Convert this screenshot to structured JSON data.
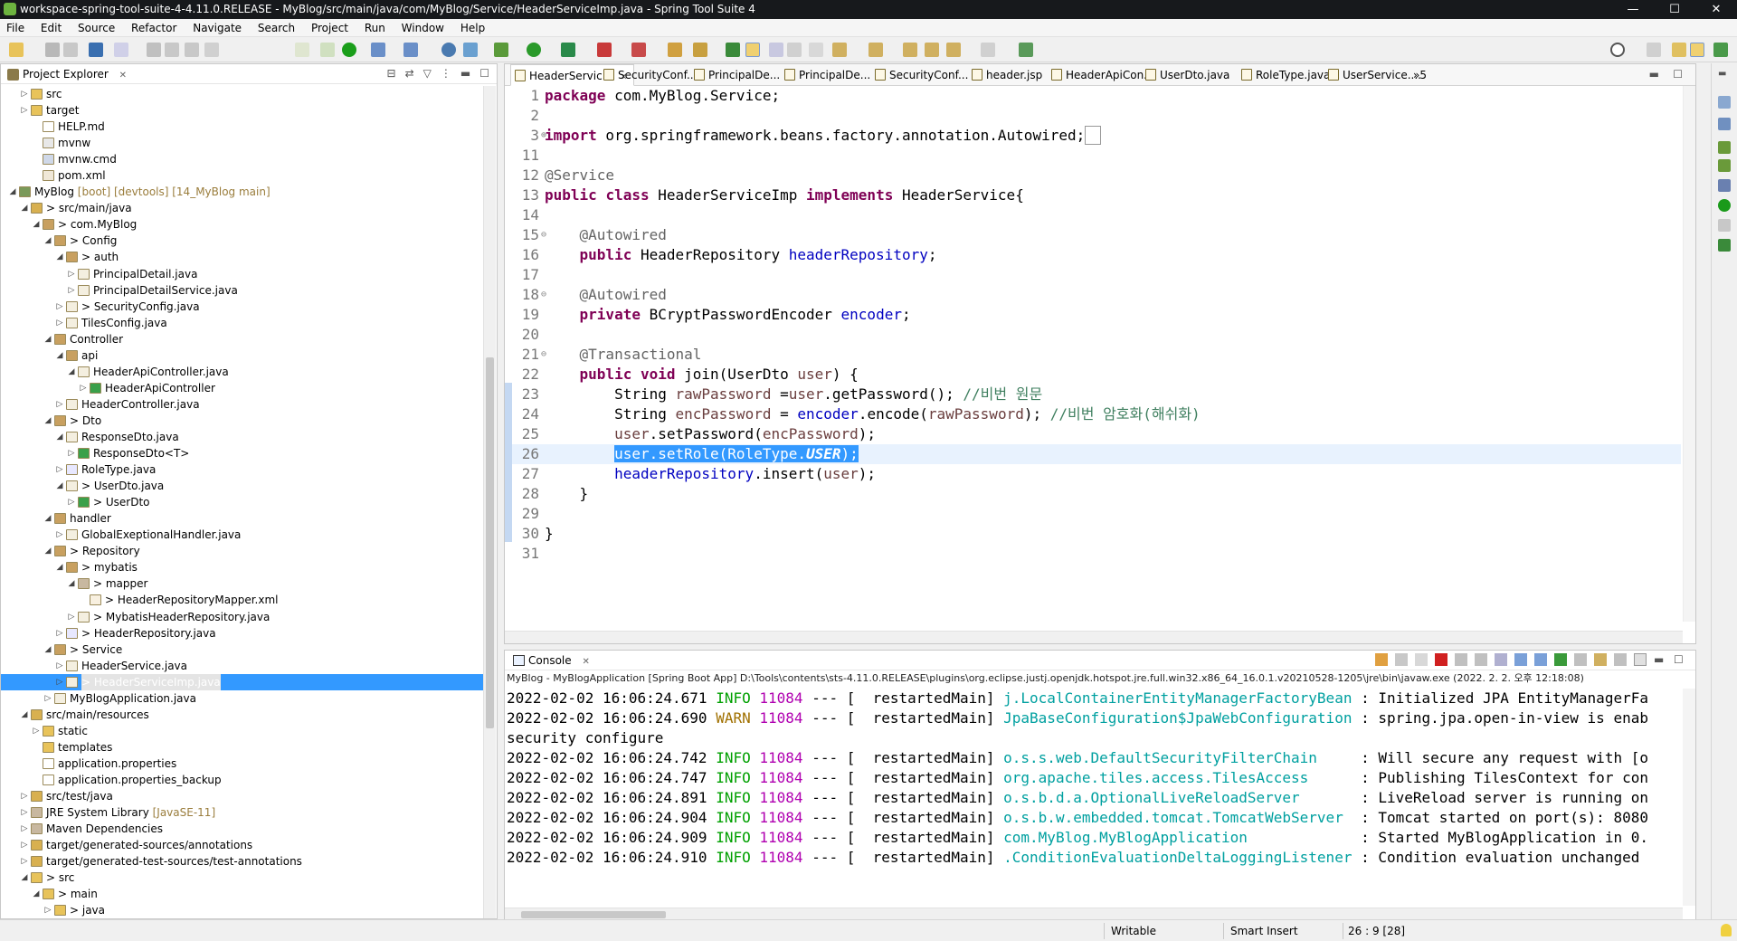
{
  "window": {
    "title": "workspace-spring-tool-suite-4-4.11.0.RELEASE - MyBlog/src/main/java/com/MyBlog/Service/HeaderServiceImp.java - Spring Tool Suite 4",
    "minimize": "—",
    "maximize": "☐",
    "close": "✕"
  },
  "menu": [
    "File",
    "Edit",
    "Source",
    "Refactor",
    "Navigate",
    "Search",
    "Project",
    "Run",
    "Window",
    "Help"
  ],
  "explorer": {
    "title": "Project Explorer",
    "close": "✕",
    "items": [
      {
        "label": "src",
        "deco": ""
      },
      {
        "label": "target",
        "deco": ""
      },
      {
        "label": "HELP.md",
        "deco": ""
      },
      {
        "label": "mvnw",
        "deco": ""
      },
      {
        "label": "mvnw.cmd",
        "deco": ""
      },
      {
        "label": "pom.xml",
        "deco": ""
      },
      {
        "label": "MyBlog",
        "deco": " [boot] [devtools] [14_MyBlog main]"
      },
      {
        "label": "> src/main/java",
        "deco": ""
      },
      {
        "label": "> com.MyBlog",
        "deco": ""
      },
      {
        "label": "> Config",
        "deco": ""
      },
      {
        "label": "> auth",
        "deco": ""
      },
      {
        "label": "PrincipalDetail.java",
        "deco": ""
      },
      {
        "label": "PrincipalDetailService.java",
        "deco": ""
      },
      {
        "label": "> SecurityConfig.java",
        "deco": ""
      },
      {
        "label": "TilesConfig.java",
        "deco": ""
      },
      {
        "label": "Controller",
        "deco": ""
      },
      {
        "label": "api",
        "deco": ""
      },
      {
        "label": "HeaderApiController.java",
        "deco": ""
      },
      {
        "label": "HeaderApiController",
        "deco": ""
      },
      {
        "label": "HeaderController.java",
        "deco": ""
      },
      {
        "label": "> Dto",
        "deco": ""
      },
      {
        "label": "ResponseDto.java",
        "deco": ""
      },
      {
        "label": "ResponseDto<T>",
        "deco": ""
      },
      {
        "label": "RoleType.java",
        "deco": ""
      },
      {
        "label": "> UserDto.java",
        "deco": ""
      },
      {
        "label": "> UserDto",
        "deco": ""
      },
      {
        "label": "handler",
        "deco": ""
      },
      {
        "label": "GlobalExeptionalHandler.java",
        "deco": ""
      },
      {
        "label": "> Repository",
        "deco": ""
      },
      {
        "label": "> mybatis",
        "deco": ""
      },
      {
        "label": "> mapper",
        "deco": ""
      },
      {
        "label": "> HeaderRepositoryMapper.xml",
        "deco": ""
      },
      {
        "label": "> MybatisHeaderRepository.java",
        "deco": ""
      },
      {
        "label": "> HeaderRepository.java",
        "deco": ""
      },
      {
        "label": "> Service",
        "deco": ""
      },
      {
        "label": "HeaderService.java",
        "deco": ""
      },
      {
        "label": "> HeaderServiceImp.java",
        "deco": ""
      },
      {
        "label": "MyBlogApplication.java",
        "deco": ""
      },
      {
        "label": "src/main/resources",
        "deco": ""
      },
      {
        "label": "static",
        "deco": ""
      },
      {
        "label": "templates",
        "deco": ""
      },
      {
        "label": "application.properties",
        "deco": ""
      },
      {
        "label": "application.properties_backup",
        "deco": ""
      },
      {
        "label": "src/test/java",
        "deco": ""
      },
      {
        "label": "JRE System Library",
        "deco": " [JavaSE-11]"
      },
      {
        "label": "Maven Dependencies",
        "deco": ""
      },
      {
        "label": "target/generated-sources/annotations",
        "deco": ""
      },
      {
        "label": "target/generated-test-sources/test-annotations",
        "deco": ""
      },
      {
        "label": "> src",
        "deco": ""
      },
      {
        "label": "> main",
        "deco": ""
      },
      {
        "label": "> java",
        "deco": ""
      }
    ]
  },
  "editor": {
    "tabs": [
      "HeaderServic...",
      "SecurityConf...",
      "PrincipalDe...",
      "PrincipalDe...",
      "SecurityConf...",
      "header.jsp",
      "HeaderApiCon...",
      "UserDto.java",
      "RoleType.java",
      "UserService...."
    ],
    "overflow": "»5",
    "line_numbers": [
      "1",
      "2",
      "3",
      "11",
      "12",
      "13",
      "14",
      "15",
      "16",
      "17",
      "18",
      "19",
      "20",
      "21",
      "22",
      "23",
      "24",
      "25",
      "26",
      "27",
      "28",
      "29",
      "30",
      "31"
    ]
  },
  "console": {
    "title": "Console",
    "process": "MyBlog - MyBlogApplication [Spring Boot App] D:\\Tools\\contents\\sts-4.11.0.RELEASE\\plugins\\org.eclipse.justj.openjdk.hotspot.jre.full.win32.x86_64_16.0.1.v20210528-1205\\jre\\bin\\javaw.exe  (2022. 2. 2. 오후 12:18:08)",
    "lines": [
      {
        "ts": "2022-02-02 16:06:24.671",
        "lvl": "INFO",
        "pid": "11084",
        "th": "---",
        "thread": "[  restartedMain]",
        "logger": "j.LocalContainerEntityManagerFactoryBean",
        "msg": ": Initialized JPA EntityManagerFa"
      },
      {
        "ts": "2022-02-02 16:06:24.690",
        "lvl": "WARN",
        "pid": "11084",
        "th": "---",
        "thread": "[  restartedMain]",
        "logger": "JpaBaseConfiguration$JpaWebConfiguration",
        "msg": ": spring.jpa.open-in-view is enab"
      },
      {
        "plain": "security configure"
      },
      {
        "ts": "2022-02-02 16:06:24.742",
        "lvl": "INFO",
        "pid": "11084",
        "th": "---",
        "thread": "[  restartedMain]",
        "logger": "o.s.s.web.DefaultSecurityFilterChain    ",
        "msg": ": Will secure any request with [o"
      },
      {
        "ts": "2022-02-02 16:06:24.747",
        "lvl": "INFO",
        "pid": "11084",
        "th": "---",
        "thread": "[  restartedMain]",
        "logger": "org.apache.tiles.access.TilesAccess     ",
        "msg": ": Publishing TilesContext for con"
      },
      {
        "ts": "2022-02-02 16:06:24.891",
        "lvl": "INFO",
        "pid": "11084",
        "th": "---",
        "thread": "[  restartedMain]",
        "logger": "o.s.b.d.a.OptionalLiveReloadServer      ",
        "msg": ": LiveReload server is running on"
      },
      {
        "ts": "2022-02-02 16:06:24.904",
        "lvl": "INFO",
        "pid": "11084",
        "th": "---",
        "thread": "[  restartedMain]",
        "logger": "o.s.b.w.embedded.tomcat.TomcatWebServer ",
        "msg": ": Tomcat started on port(s): 8080"
      },
      {
        "ts": "2022-02-02 16:06:24.909",
        "lvl": "INFO",
        "pid": "11084",
        "th": "---",
        "thread": "[  restartedMain]",
        "logger": "com.MyBlog.MyBlogApplication            ",
        "msg": ": Started MyBlogApplication in 0."
      },
      {
        "ts": "2022-02-02 16:06:24.910",
        "lvl": "INFO",
        "pid": "11084",
        "th": "---",
        "thread": "[  restartedMain]",
        "logger": ".ConditionEvaluationDeltaLoggingListener",
        "msg": ": Condition evaluation unchanged"
      }
    ]
  },
  "status": {
    "writable": "Writable",
    "insert_mode": "Smart Insert",
    "position": "26 : 9 [28]"
  }
}
